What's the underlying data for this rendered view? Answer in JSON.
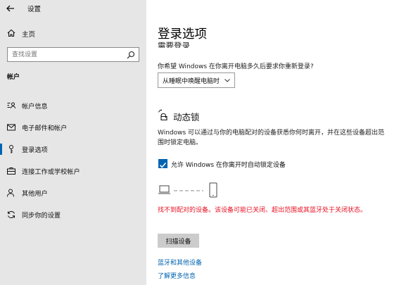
{
  "window": {
    "title": "设置"
  },
  "sidebar": {
    "home_label": "主页",
    "search_placeholder": "查找设置",
    "section_label": "帐户",
    "items": [
      {
        "label": "帐户信息",
        "icon": "person-card-icon",
        "active": false
      },
      {
        "label": "电子邮件和帐户",
        "icon": "mail-icon",
        "active": false
      },
      {
        "label": "登录选项",
        "icon": "key-icon",
        "active": true
      },
      {
        "label": "连接工作或学校帐户",
        "icon": "briefcase-icon",
        "active": false
      },
      {
        "label": "其他用户",
        "icon": "person-add-icon",
        "active": false
      },
      {
        "label": "同步你的设置",
        "icon": "sync-icon",
        "active": false
      }
    ]
  },
  "main": {
    "page_title": "登录选项",
    "require_signin_heading": "需要登录",
    "require_signin_question": "你希望 Windows 在你离开电脑多久后要求你重新登录?",
    "require_signin_value": "从睡眠中唤醒电脑时",
    "dynamic_lock": {
      "title": "动态锁",
      "description": "Windows 可以通过与你的电脑配对的设备获悉你何时离开，并在这些设备超出范围时锁定电脑。",
      "checkbox_label": "允许 Windows 在你离开时自动锁定设备",
      "checkbox_checked": true,
      "error_text": "找不到配对的设备。该设备可能已关闭、超出范围或其蓝牙处于关闭状态。",
      "scan_button": "扫描设备"
    },
    "links": {
      "bluetooth": "蓝牙和其他设备",
      "learn_more": "了解更多信息"
    }
  },
  "colors": {
    "accent": "#0063b1",
    "error": "#e81123",
    "sidebar_bg": "#e6e6e6"
  }
}
